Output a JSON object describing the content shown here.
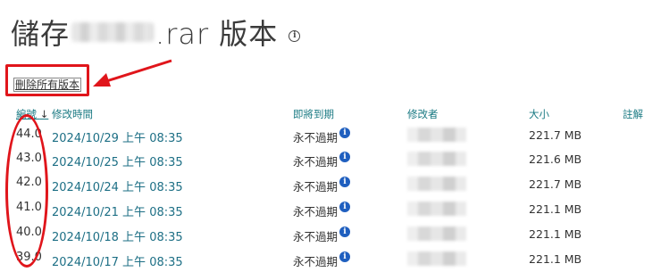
{
  "title": {
    "prefix": "儲存",
    "suffix": ".rar 版本"
  },
  "toolbar": {
    "delete_all": "刪除所有版本"
  },
  "columns": {
    "number": "編號",
    "sort_arrow": "↓",
    "modified": "修改時間",
    "expires": "即將到期",
    "modified_by": "修改者",
    "size": "大小",
    "comment": "註解"
  },
  "versions": [
    {
      "number": "44.0",
      "date": "2024/10/29 上午 08:35",
      "expires": "永不過期",
      "size": "221.7 MB"
    },
    {
      "number": "43.0",
      "date": "2024/10/25 上午 08:35",
      "expires": "永不過期",
      "size": "221.6 MB"
    },
    {
      "number": "42.0",
      "date": "2024/10/24 上午 08:35",
      "expires": "永不過期",
      "size": "221.7 MB"
    },
    {
      "number": "41.0",
      "date": "2024/10/21 上午 08:35",
      "expires": "永不過期",
      "size": "221.1 MB"
    },
    {
      "number": "40.0",
      "date": "2024/10/18 上午 08:35",
      "expires": "永不過期",
      "size": "221.1 MB"
    },
    {
      "number": "39.0",
      "date": "2024/10/17 上午 08:35",
      "expires": "永不過期",
      "size": "221.1 MB"
    }
  ],
  "icons": {
    "title_info": "info-outline-icon",
    "row_info": "info-filled-icon"
  },
  "colors": {
    "annotation": "#e0151b",
    "link": "#1d6f85",
    "header": "#1a7a83",
    "info": "#1f5fbf"
  }
}
